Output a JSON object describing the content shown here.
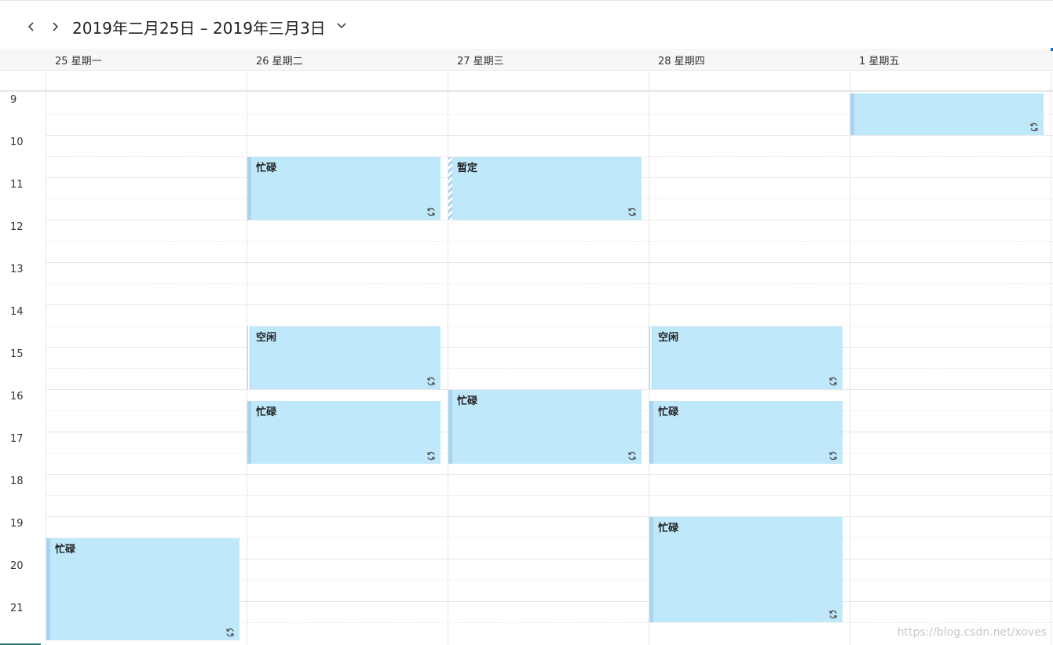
{
  "toolbar": {
    "prev_icon": "chevron-left-icon",
    "next_icon": "chevron-right-icon",
    "date_range": "2019年二月25日 – 2019年三月3日",
    "dropdown_icon": "chevron-down-icon"
  },
  "days": [
    {
      "label": "25 星期一"
    },
    {
      "label": "26 星期二"
    },
    {
      "label": "27 星期三"
    },
    {
      "label": "28 星期四"
    },
    {
      "label": "1 星期五"
    }
  ],
  "hours": [
    "9",
    "10",
    "11",
    "12",
    "13",
    "14",
    "15",
    "16",
    "17",
    "18",
    "19",
    "20",
    "21"
  ],
  "events": [
    {
      "day": "1 星期五",
      "start": "9:00",
      "end": "10:00",
      "title": "",
      "status": "busy",
      "recurring": true
    },
    {
      "day": "26 星期二",
      "start": "10:30",
      "end": "12:00",
      "title": "忙碌",
      "status": "busy",
      "recurring": true
    },
    {
      "day": "27 星期三",
      "start": "10:30",
      "end": "12:00",
      "title": "暂定",
      "status": "tentative",
      "recurring": true
    },
    {
      "day": "26 星期二",
      "start": "14:30",
      "end": "16:00",
      "title": "空闲",
      "status": "free",
      "recurring": true
    },
    {
      "day": "28 星期四",
      "start": "14:30",
      "end": "16:00",
      "title": "空闲",
      "status": "free",
      "recurring": true
    },
    {
      "day": "26 星期二",
      "start": "16:15",
      "end": "17:45",
      "title": "忙碌",
      "status": "busy",
      "recurring": true
    },
    {
      "day": "27 星期三",
      "start": "16:00",
      "end": "17:45",
      "title": "忙碌",
      "status": "busy",
      "recurring": true
    },
    {
      "day": "28 星期四",
      "start": "16:15",
      "end": "17:45",
      "title": "忙碌",
      "status": "busy",
      "recurring": true
    },
    {
      "day": "28 星期四",
      "start": "19:00",
      "end": "21:30",
      "title": "忙碌",
      "status": "busy",
      "recurring": true
    },
    {
      "day": "25 星期一",
      "start": "19:30",
      "end": "22:00",
      "title": "忙碌",
      "status": "busy",
      "recurring": true
    }
  ],
  "colors": {
    "event_fill": "#c0e8fb",
    "event_bar": "#a9d4f1",
    "accent": "#0078d4"
  },
  "watermark": "https://blog.csdn.net/xoves"
}
